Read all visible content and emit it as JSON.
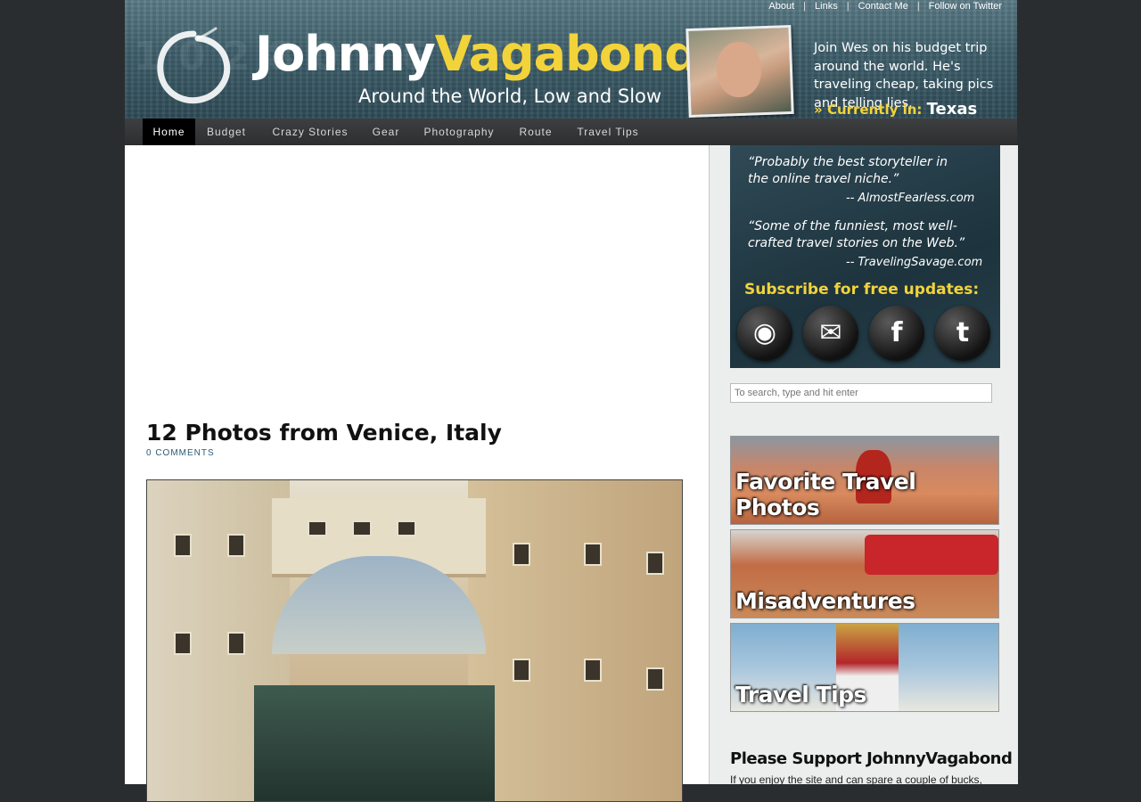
{
  "top_links": {
    "about": "About",
    "links": "Links",
    "contact": "Contact Me",
    "twitter": "Follow on Twitter",
    "separator": "|"
  },
  "header": {
    "logo_first": "Johnny",
    "logo_last": "Vagabond",
    "tagline": "Around the World, Low and Slow",
    "blurb": "Join Wes on his budget trip around the world. He's traveling cheap, taking pics and telling lies.",
    "currently_label": "Currently in:",
    "currently_place": "Texas"
  },
  "nav": {
    "items": [
      {
        "label": "Home",
        "active": true
      },
      {
        "label": "Budget"
      },
      {
        "label": "Crazy Stories"
      },
      {
        "label": "Gear"
      },
      {
        "label": "Photography"
      },
      {
        "label": "Route"
      },
      {
        "label": "Travel Tips"
      }
    ]
  },
  "post": {
    "title": "12 Photos from Venice, Italy",
    "comments": "0 COMMENTS"
  },
  "sidebar": {
    "promo": {
      "quote1": "“Probably the best storyteller in the online travel niche.”",
      "attrib1": "-- AlmostFearless.com",
      "quote2": "“Some of the funniest, most well-crafted travel stories on the Web.”",
      "attrib2": "-- TravelingSavage.com",
      "subscribe": "Subscribe for free updates:"
    },
    "search_placeholder": "To search, type and hit enter",
    "banners": [
      {
        "label": "Favorite Travel Photos"
      },
      {
        "label": "Misadventures"
      },
      {
        "label": "Travel Tips"
      }
    ],
    "support_title": "Please Support JohnnyVagabond",
    "support_text": "If you enjoy the site and can spare a couple of bucks,"
  }
}
